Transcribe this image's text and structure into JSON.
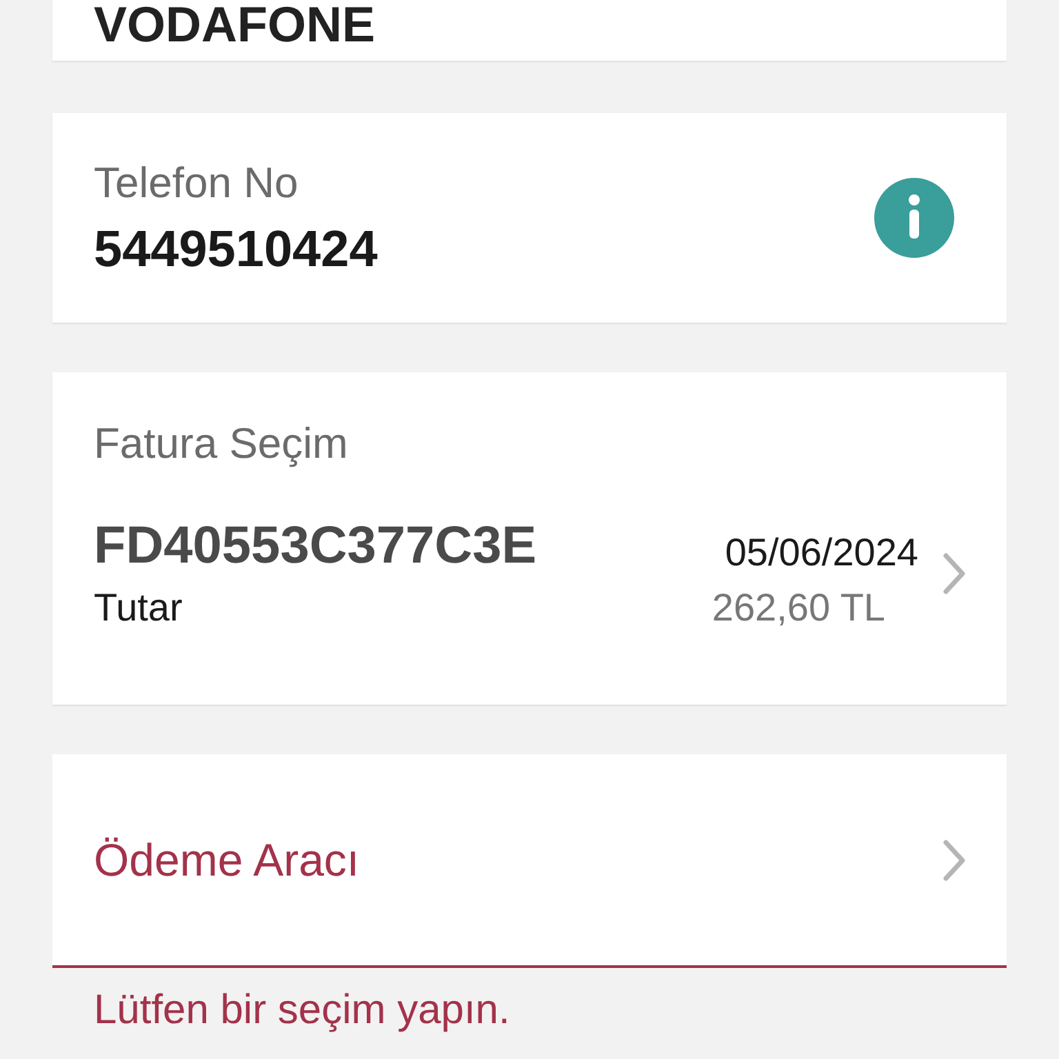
{
  "operator_card": {
    "name": "VODAFONE"
  },
  "phone_card": {
    "label": "Telefon No",
    "value": "5449510424"
  },
  "invoice_card": {
    "label": "Fatura Seçim",
    "invoice_no": "FD40553C377C3E",
    "date": "05/06/2024",
    "amount_label": "Tutar",
    "amount": "262,60 TL"
  },
  "payment_card": {
    "label": "Ödeme Aracı",
    "invalid": true,
    "error": "Lütfen bir seçim yapın."
  }
}
